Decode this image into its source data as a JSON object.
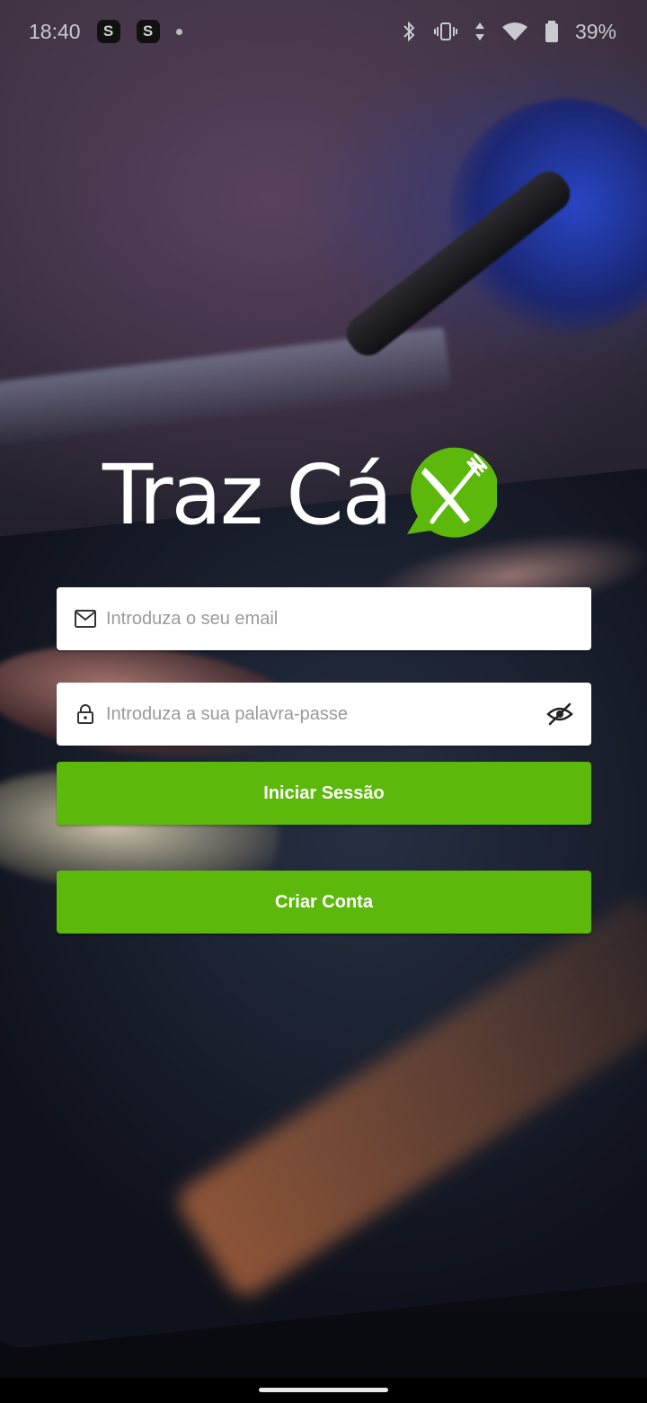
{
  "status_bar": {
    "time": "18:40",
    "app_badge_1": "S",
    "app_badge_2": "S",
    "battery": "39%"
  },
  "logo": {
    "text": "Traz Cá",
    "brand_color": "#5cb80b",
    "icon": "fork-knife-chat-icon"
  },
  "form": {
    "email": {
      "placeholder": "Introduza o seu email",
      "value": "",
      "icon": "mail-icon"
    },
    "password": {
      "placeholder": "Introduza a sua palavra-passe",
      "value": "",
      "icon": "lock-icon",
      "toggle_icon": "eye-off-icon"
    },
    "login_button": "Iniciar Sessão",
    "signup_button": "Criar Conta"
  },
  "colors": {
    "primary_button": "#5cb80b",
    "field_background": "#ffffff"
  }
}
